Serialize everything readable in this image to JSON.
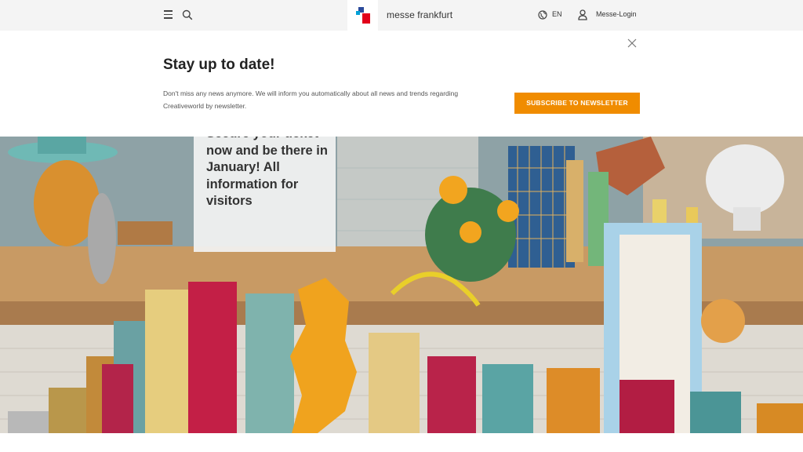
{
  "header": {
    "brand": "messe frankfurt",
    "language": "EN",
    "login_label": "Messe-Login",
    "icons": [
      "menu-icon",
      "search-icon",
      "globe-icon",
      "user-icon"
    ],
    "logo_colors": [
      "#2b4a9b",
      "#e2001a",
      "#00a0d6"
    ]
  },
  "newsletter": {
    "title": "Stay up to date!",
    "text": "Don't miss any news anymore. We will inform you automatically about all news and trends regarding Creativeworld by newsletter.",
    "button_label": "SUBSCRIBE TO NEWSLETTER",
    "button_color": "#f08c00",
    "close_icon": "close-icon"
  },
  "hero": {
    "card_text": "Secure your ticket now and be there in January! All information for visitors",
    "arrow_icon": "arrow-right-icon"
  }
}
